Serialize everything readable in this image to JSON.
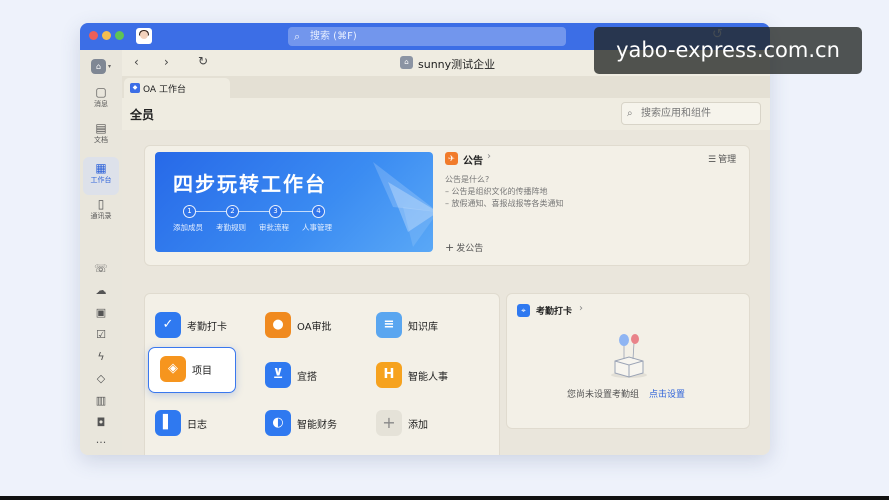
{
  "titlebar": {
    "search_placeholder": "搜索 (⌘F)"
  },
  "sidebar": {
    "items": [
      {
        "label": "消息",
        "icon": "chat-bubble-icon"
      },
      {
        "label": "文档",
        "icon": "document-icon"
      },
      {
        "label": "工作台",
        "icon": "grid-icon",
        "active": true
      },
      {
        "label": "通讯录",
        "icon": "contacts-icon"
      }
    ],
    "more_glyph": "···"
  },
  "navbar": {
    "company": "sunny测试企业"
  },
  "tab": {
    "label": "OA 工作台"
  },
  "page": {
    "title": "全员",
    "search_placeholder": "搜索应用和组件"
  },
  "banner": {
    "title": "四步玩转工作台",
    "steps": [
      {
        "num": "1",
        "label": "添加成员"
      },
      {
        "num": "2",
        "label": "考勤规则"
      },
      {
        "num": "3",
        "label": "审批流程"
      },
      {
        "num": "4",
        "label": "人事管理"
      }
    ]
  },
  "notice": {
    "title": "公告",
    "manage": "管理",
    "lines": [
      "公告是什么?",
      "– 公告是组织文化的传播阵地",
      "– 放假通知、喜报战报等各类通知"
    ],
    "publish": "发公告"
  },
  "apps": [
    {
      "label": "考勤打卡",
      "icon": "check-shield-icon",
      "color": "#2f79f0",
      "glyph": "✓"
    },
    {
      "label": "OA审批",
      "icon": "approval-person-icon",
      "color": "#f08a1f",
      "glyph": "●"
    },
    {
      "label": "知识库",
      "icon": "knowledge-book-icon",
      "color": "#5aa6f0",
      "glyph": "≡"
    },
    {
      "label": "项目",
      "icon": "project-layers-icon",
      "color": "#f6951e",
      "glyph": "◈"
    },
    {
      "label": "宜搭",
      "icon": "yida-icon",
      "color": "#2f79f0",
      "glyph": "⊻"
    },
    {
      "label": "智能人事",
      "icon": "hr-icon",
      "color": "#f6a21e",
      "glyph": "H"
    },
    {
      "label": "日志",
      "icon": "journal-icon",
      "color": "#2f79f0",
      "glyph": "▌"
    },
    {
      "label": "智能财务",
      "icon": "finance-icon",
      "color": "#2f79f0",
      "glyph": "◐"
    },
    {
      "label": "添加",
      "icon": "plus-icon",
      "color": "#e5e2d8",
      "glyph": "+"
    }
  ],
  "attendance": {
    "title": "考勤打卡",
    "empty": "您尚未设置考勤组",
    "link": "点击设置"
  },
  "watermark": "yabo-express.com.cn"
}
